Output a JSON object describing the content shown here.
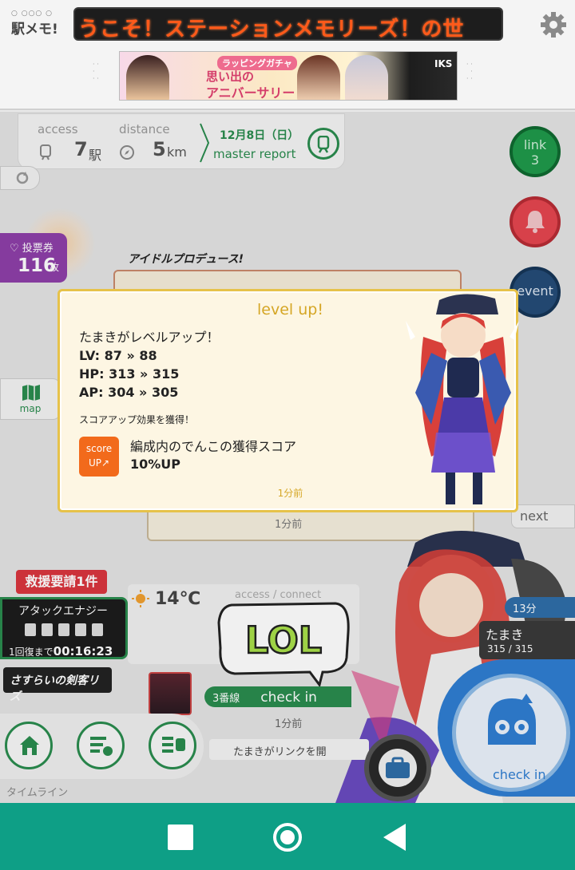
{
  "header": {
    "logo_dots": "○ ○○○ ○",
    "logo_text": "駅メモ!",
    "marquee": "うこそ！ステーションメモリーズ！の世",
    "banner_badge": "ラッピングガチャ",
    "banner_line1": "思い出の",
    "banner_line2": "アニバーサリー",
    "banner_right": "IKS"
  },
  "stats": {
    "access_label": "access",
    "access_value": "7",
    "access_unit": "駅",
    "distance_label": "distance",
    "distance_value": "5",
    "distance_unit": "km",
    "report_date": "12月8日（日）",
    "report_label": "master report"
  },
  "side": {
    "link_label": "link",
    "link_count": "3",
    "event_label": "event"
  },
  "vote": {
    "label": "♡ 投票券",
    "count": "116",
    "unit": "枚"
  },
  "idol_logo": "アイドルプロデュース!",
  "map_label": "map",
  "note_time": "1分前",
  "next_label": "next",
  "rescue_label": "救援要請1件",
  "energy": {
    "title": "アタックエナジー",
    "recover_label": "1回復まで",
    "recover_time": "00:16:23"
  },
  "sasurai_label": "さすらいの剣客リズ",
  "weather": {
    "temp": "14℃",
    "access_connect": "access / connect"
  },
  "checkin": {
    "line": "3番線",
    "label": "check in",
    "time": "1分前",
    "timeline_msg": "たまきがリンクを開",
    "big_label": "check in"
  },
  "lol_text": "LOL",
  "timeline_label": "タイムライン",
  "char_chip": {
    "name": "たまき",
    "hp": "315 / 315",
    "minutes": "13分"
  },
  "modal": {
    "title": "level up!",
    "line1": "たまきがレベルアップ！",
    "line2": "LV: 87 » 88",
    "line3": "HP: 313 » 315",
    "line4": "AP: 304 » 305",
    "sub": "スコアアップ効果を獲得！",
    "badge_top": "score",
    "badge_bottom": "UP↗",
    "score_line1": "編成内のでんこの獲得スコア",
    "score_line2": "10%UP",
    "time": "1分前"
  },
  "colors": {
    "accent_green": "#2a8c4e",
    "modal_gold": "#e6c24a",
    "score_orange": "#f26a1b",
    "system_nav": "#0e9f86"
  }
}
